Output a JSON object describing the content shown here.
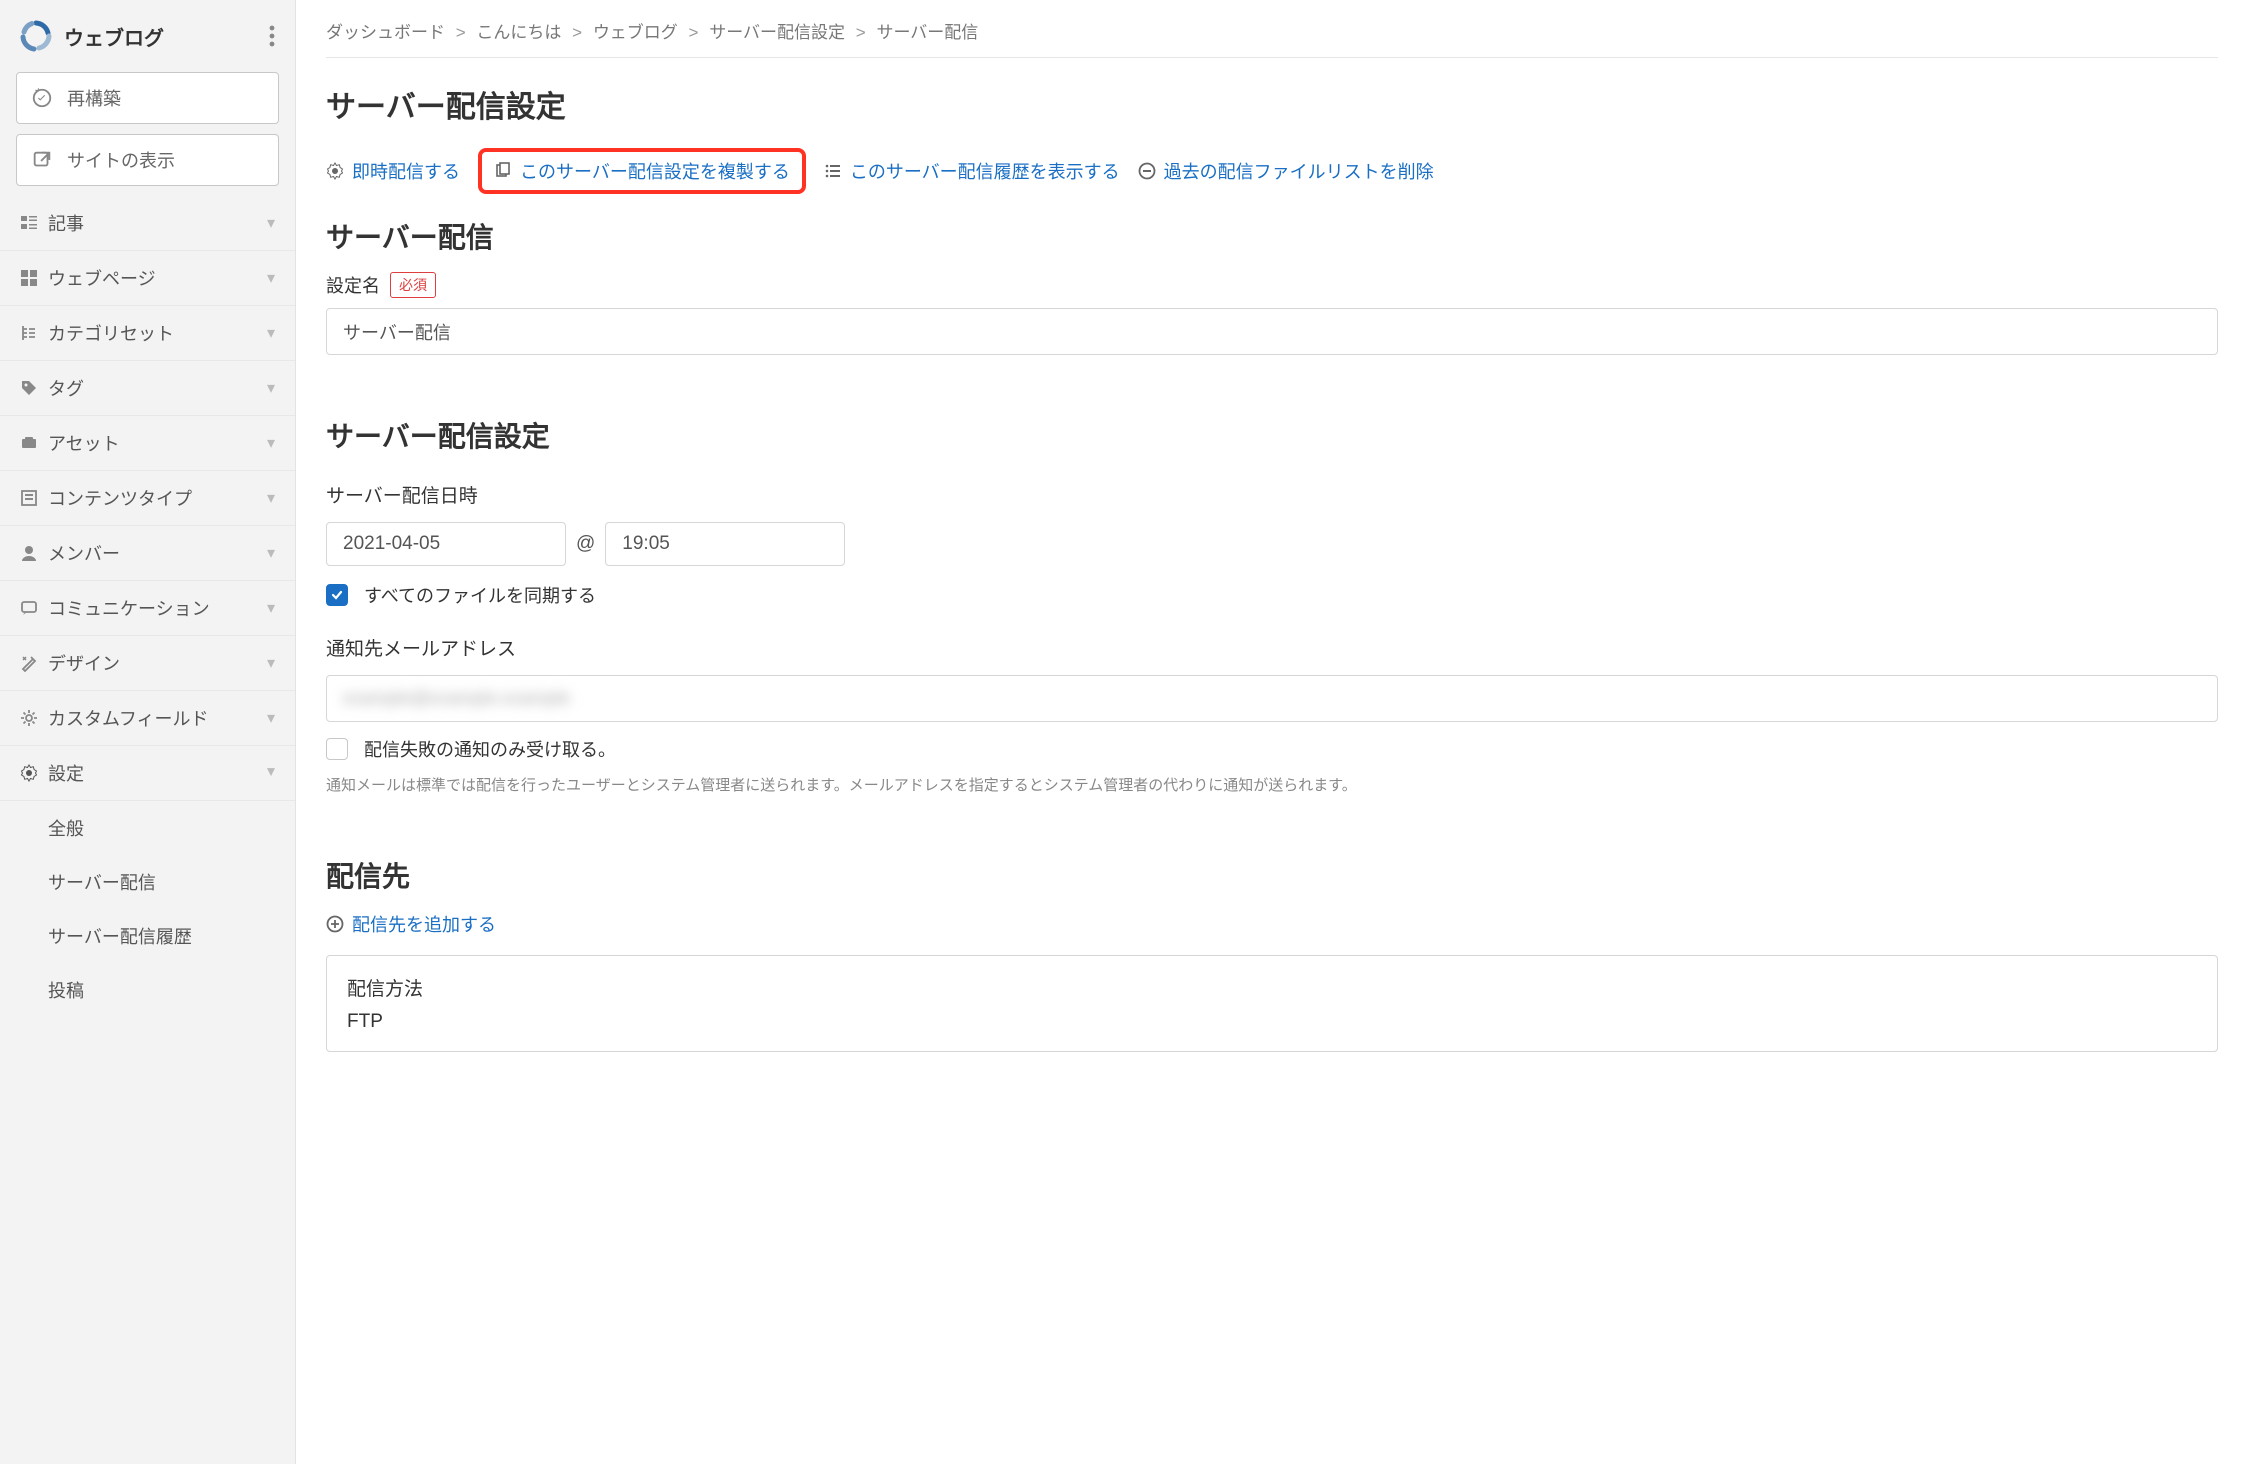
{
  "sidebar": {
    "brand": "ウェブログ",
    "rebuild_label": "再構築",
    "view_site_label": "サイトの表示",
    "nav": [
      {
        "label": "記事",
        "icon": "entries"
      },
      {
        "label": "ウェブページ",
        "icon": "pages"
      },
      {
        "label": "カテゴリセット",
        "icon": "categories"
      },
      {
        "label": "タグ",
        "icon": "tag"
      },
      {
        "label": "アセット",
        "icon": "asset"
      },
      {
        "label": "コンテンツタイプ",
        "icon": "content-type"
      },
      {
        "label": "メンバー",
        "icon": "member"
      },
      {
        "label": "コミュニケーション",
        "icon": "communication"
      },
      {
        "label": "デザイン",
        "icon": "design"
      },
      {
        "label": "カスタムフィールド",
        "icon": "custom-field"
      },
      {
        "label": "設定",
        "icon": "settings",
        "open": true
      }
    ],
    "settings_sub": [
      {
        "label": "全般"
      },
      {
        "label": "サーバー配信"
      },
      {
        "label": "サーバー配信履歴"
      },
      {
        "label": "投稿"
      }
    ]
  },
  "breadcrumb": [
    "ダッシュボード",
    "こんにちは",
    "ウェブログ",
    "サーバー配信設定",
    "サーバー配信"
  ],
  "page_title": "サーバー配信設定",
  "actions": {
    "publish_now": "即時配信する",
    "duplicate": "このサーバー配信設定を複製する",
    "view_history": "このサーバー配信履歴を表示する",
    "delete_past": "過去の配信ファイルリストを削除"
  },
  "server_dist": {
    "heading": "サーバー配信",
    "setting_name_label": "設定名",
    "required_badge": "必須",
    "setting_name_value": "サーバー配信"
  },
  "settings_section": {
    "heading": "サーバー配信設定",
    "datetime_label": "サーバー配信日時",
    "date_value": "2021-04-05",
    "at": "@",
    "time_value": "19:05",
    "sync_all_label": "すべてのファイルを同期する",
    "notify_label": "通知先メールアドレス",
    "notify_value": "example@example.example",
    "only_fail_label": "配信失敗の通知のみ受け取る。",
    "help": "通知メールは標準では配信を行ったユーザーとシステム管理者に送られます。メールアドレスを指定するとシステム管理者の代わりに通知が送られます。"
  },
  "destination": {
    "heading": "配信先",
    "add_link": "配信先を追加する",
    "method_label": "配信方法",
    "method_value": "FTP"
  }
}
